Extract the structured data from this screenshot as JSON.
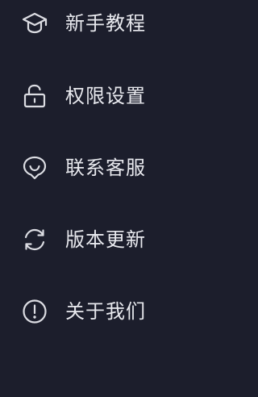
{
  "menu": {
    "items": [
      {
        "label": "新手教程",
        "icon": "graduation-cap-icon"
      },
      {
        "label": "权限设置",
        "icon": "unlock-icon"
      },
      {
        "label": "联系客服",
        "icon": "customer-service-icon"
      },
      {
        "label": "版本更新",
        "icon": "refresh-icon"
      },
      {
        "label": "关于我们",
        "icon": "info-icon"
      }
    ]
  },
  "colors": {
    "background": "#1c1e2c",
    "text": "#e8e9ee",
    "icon_stroke": "#dcdde3"
  }
}
